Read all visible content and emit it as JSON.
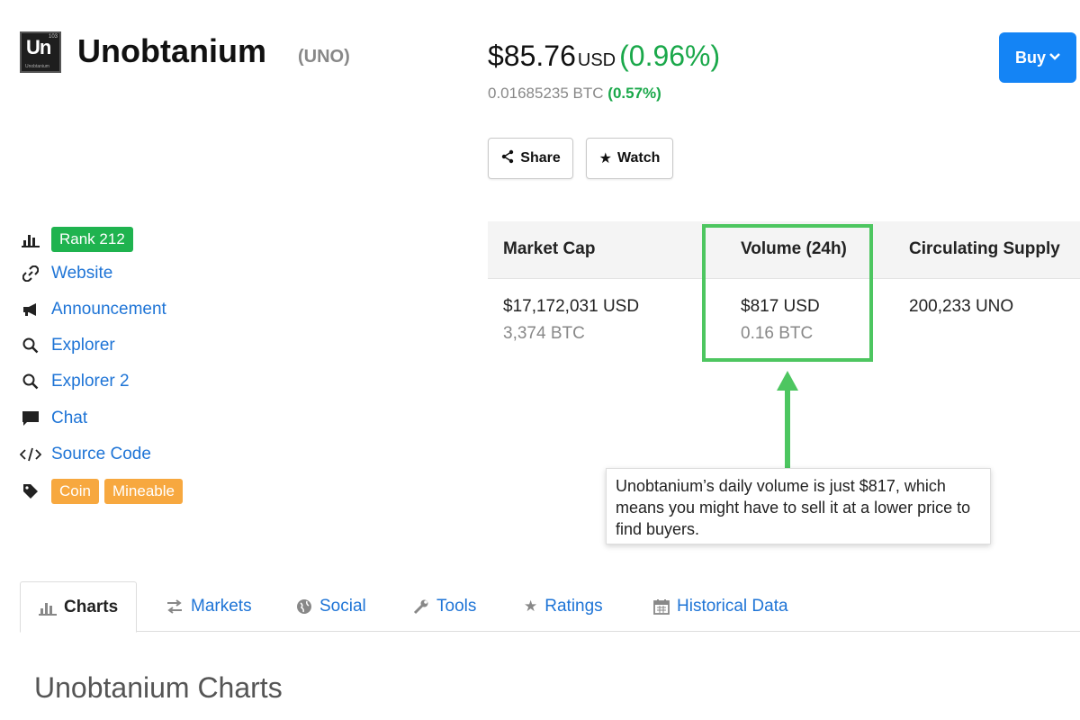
{
  "coin": {
    "logo_symbol": "Un",
    "logo_number": "103",
    "logo_caption": "Unobtanium",
    "name": "Unobtanium",
    "symbol": "(UNO)"
  },
  "price": {
    "usd": "$85.76",
    "currency": "USD",
    "usd_change": "(0.96%)",
    "btc": "0.01685235 BTC",
    "btc_change": "(0.57%)"
  },
  "actions": {
    "buy_label": "Buy",
    "share_label": "Share",
    "watch_label": "Watch"
  },
  "links": {
    "rank": "Rank 212",
    "website": "Website",
    "announcement": "Announcement",
    "explorer": "Explorer",
    "explorer2": "Explorer 2",
    "chat": "Chat",
    "source_code": "Source Code",
    "tags": [
      "Coin",
      "Mineable"
    ]
  },
  "stats": {
    "market_cap_label": "Market Cap",
    "market_cap_usd": "$17,172,031 USD",
    "market_cap_btc": "3,374 BTC",
    "volume_label": "Volume (24h)",
    "volume_usd": "$817 USD",
    "volume_btc": "0.16 BTC",
    "supply_label": "Circulating Supply",
    "supply_value": "200,233 UNO"
  },
  "annotation": {
    "text": "Unobtanium’s daily volume is just $817, which means you might have to sell it at a lower price to find buyers."
  },
  "tabs": {
    "charts": "Charts",
    "markets": "Markets",
    "social": "Social",
    "tools": "Tools",
    "ratings": "Ratings",
    "historical": "Historical Data"
  },
  "section_title": "Unobtanium Charts",
  "colors": {
    "accent_blue": "#1484f5",
    "link_blue": "#1e74d6",
    "positive_green": "#1aa84a",
    "rank_green": "#1fb34f",
    "tag_orange": "#f7a83f",
    "highlight_green": "#4dc660"
  }
}
